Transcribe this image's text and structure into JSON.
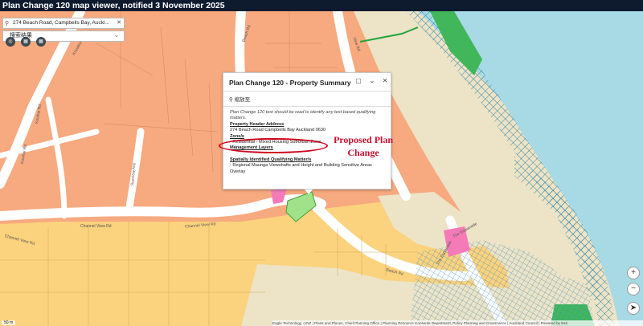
{
  "app": {
    "title": "Plan Change 120 map viewer, notified 3 November 2025"
  },
  "search": {
    "value": "274 Beach Road, Campbells Bay, Auckl..."
  },
  "results_dropdown": {
    "label": "搜索结果"
  },
  "popup": {
    "title": "Plan Change 120 - Property Summary",
    "zoom_label": "缩放至",
    "intro": "Plan Change 120 text should be read to identify any text-based qualifying matters.",
    "property_header_heading": "Property Header Address",
    "property_header_value": "274 Beach Road Campbells Bay Auckland 0630",
    "zone_heading": "Zone/s",
    "zone_value": "- Residential - Mixed Housing Suburban Zone",
    "management_heading": "Management Layers",
    "qualifying_heading": "Spatially Identified Qualifying Matter/s",
    "qualifying_value": "- Regional Maunga Viewshafts and Height and Building Sensitive Areas Overlay"
  },
  "annotation": {
    "line1": "Proposed Plan",
    "line2": "Change"
  },
  "road_labels": {
    "beach_rd_top": "Beach Rd",
    "view_rd": "View Rd",
    "knowles_rd": "Knowles Rd",
    "kowhai_rd": "Kowhai Rd",
    "seaview_ave": "Seaview Ave",
    "channel_view_rd_left": "Channel View Rd",
    "channel_view_rd_mid": "Channel View Rd",
    "beach_rd_mid": "Beach Rd",
    "beach_rd_bottom": "Beach Rd",
    "the_esplanade_a": "The Esplanade",
    "the_esplanade_b": "The Esplanade"
  },
  "attribution": "Eagle Technology, LINZ | Plans and Places, Chief Planning Office | Planning Resource Consents Department, Policy Planning and Governance | Auckland Council | Powered by Esri",
  "scale": "50 m",
  "colors": {
    "titlebar": "#0e1a2e",
    "residential_orange": "#f7a97f",
    "mixed_housing_yellow": "#fbd27d",
    "road": "#ffffff",
    "open_space_green": "#41b65b",
    "sea": "#a8dae6",
    "beach": "#ede3c6",
    "coastal_hatch": "#1f7ea1",
    "subject_site": "#9fe28a",
    "annotation_red": "#c8102e"
  },
  "icons": {
    "zoom_in": "plus-icon",
    "zoom_out": "minus-icon",
    "compass": "compass-icon",
    "maximize": "maximize-icon",
    "collapse": "chevron-down-icon",
    "close": "close-icon"
  }
}
